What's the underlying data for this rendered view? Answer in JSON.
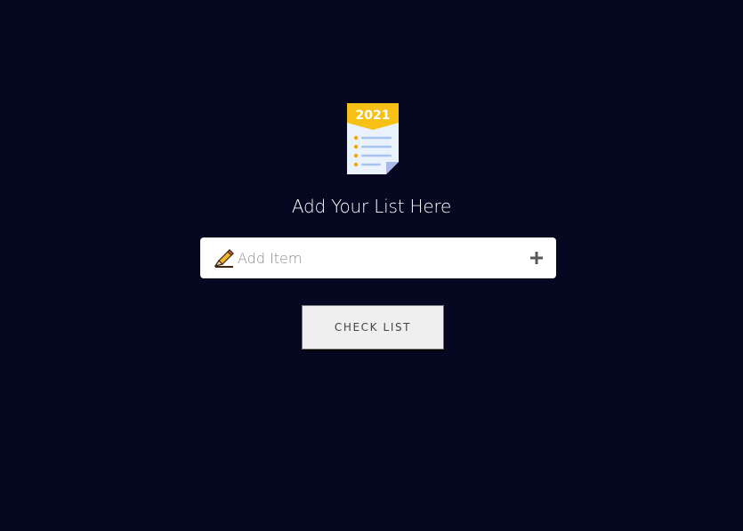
{
  "logo": {
    "year": "2021",
    "icon": "checklist-icon",
    "colors": {
      "banner": "#f6c114",
      "paper": "#eaf2fb",
      "lines": "#a8c3ee",
      "dots": "#f6a600",
      "fold": "#aab8e8"
    }
  },
  "heading": "Add Your List Here",
  "input": {
    "placeholder": "Add Item",
    "value": "",
    "leading_icon": "pencil-icon",
    "add_icon": "plus-icon"
  },
  "check_button": {
    "label": "CHECK LIST"
  },
  "theme": {
    "background": "#060822",
    "heading_color": "#ffffff"
  }
}
